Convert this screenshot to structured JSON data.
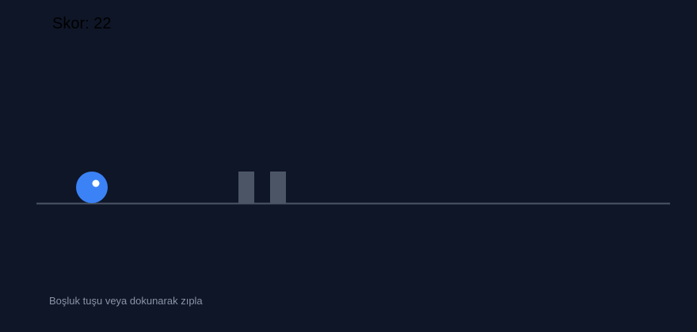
{
  "hud": {
    "score_label": "Skor: 22"
  },
  "instructions": {
    "text": "Boşluk tuşu veya dokunarak zıpla"
  },
  "colors": {
    "background": "#0f1627",
    "ground": "#4b5565",
    "player": "#3b82f6",
    "player_eye": "#ffffff",
    "obstacle": "#4b5565",
    "hint_text": "#8a94a8"
  },
  "scene": {
    "player": {
      "shape": "ball",
      "state": "on-ground"
    },
    "obstacles": [
      {
        "type": "block"
      },
      {
        "type": "block"
      }
    ]
  }
}
